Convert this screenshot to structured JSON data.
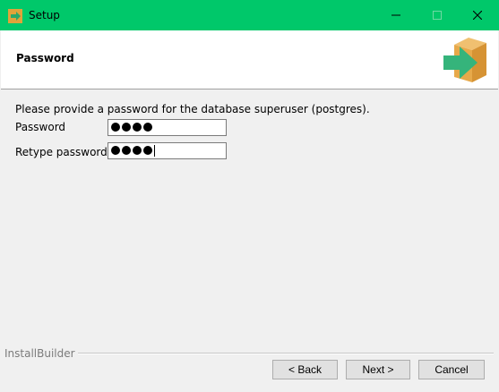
{
  "window": {
    "title": "Setup"
  },
  "header": {
    "title": "Password"
  },
  "content": {
    "description": "Please provide a password for the database superuser (postgres).",
    "password": {
      "label": "Password",
      "masked_length": 4
    },
    "retype": {
      "label": "Retype password",
      "masked_length": 4
    }
  },
  "footer": {
    "brand": "InstallBuilder"
  },
  "buttons": {
    "back": "< Back",
    "next": "Next >",
    "cancel": "Cancel"
  },
  "icons": {
    "app": "installer-arrow-icon",
    "header_logo": "box-arrow-icon"
  },
  "colors": {
    "titlebar": "#00c86a",
    "background": "#f0f0f0"
  }
}
